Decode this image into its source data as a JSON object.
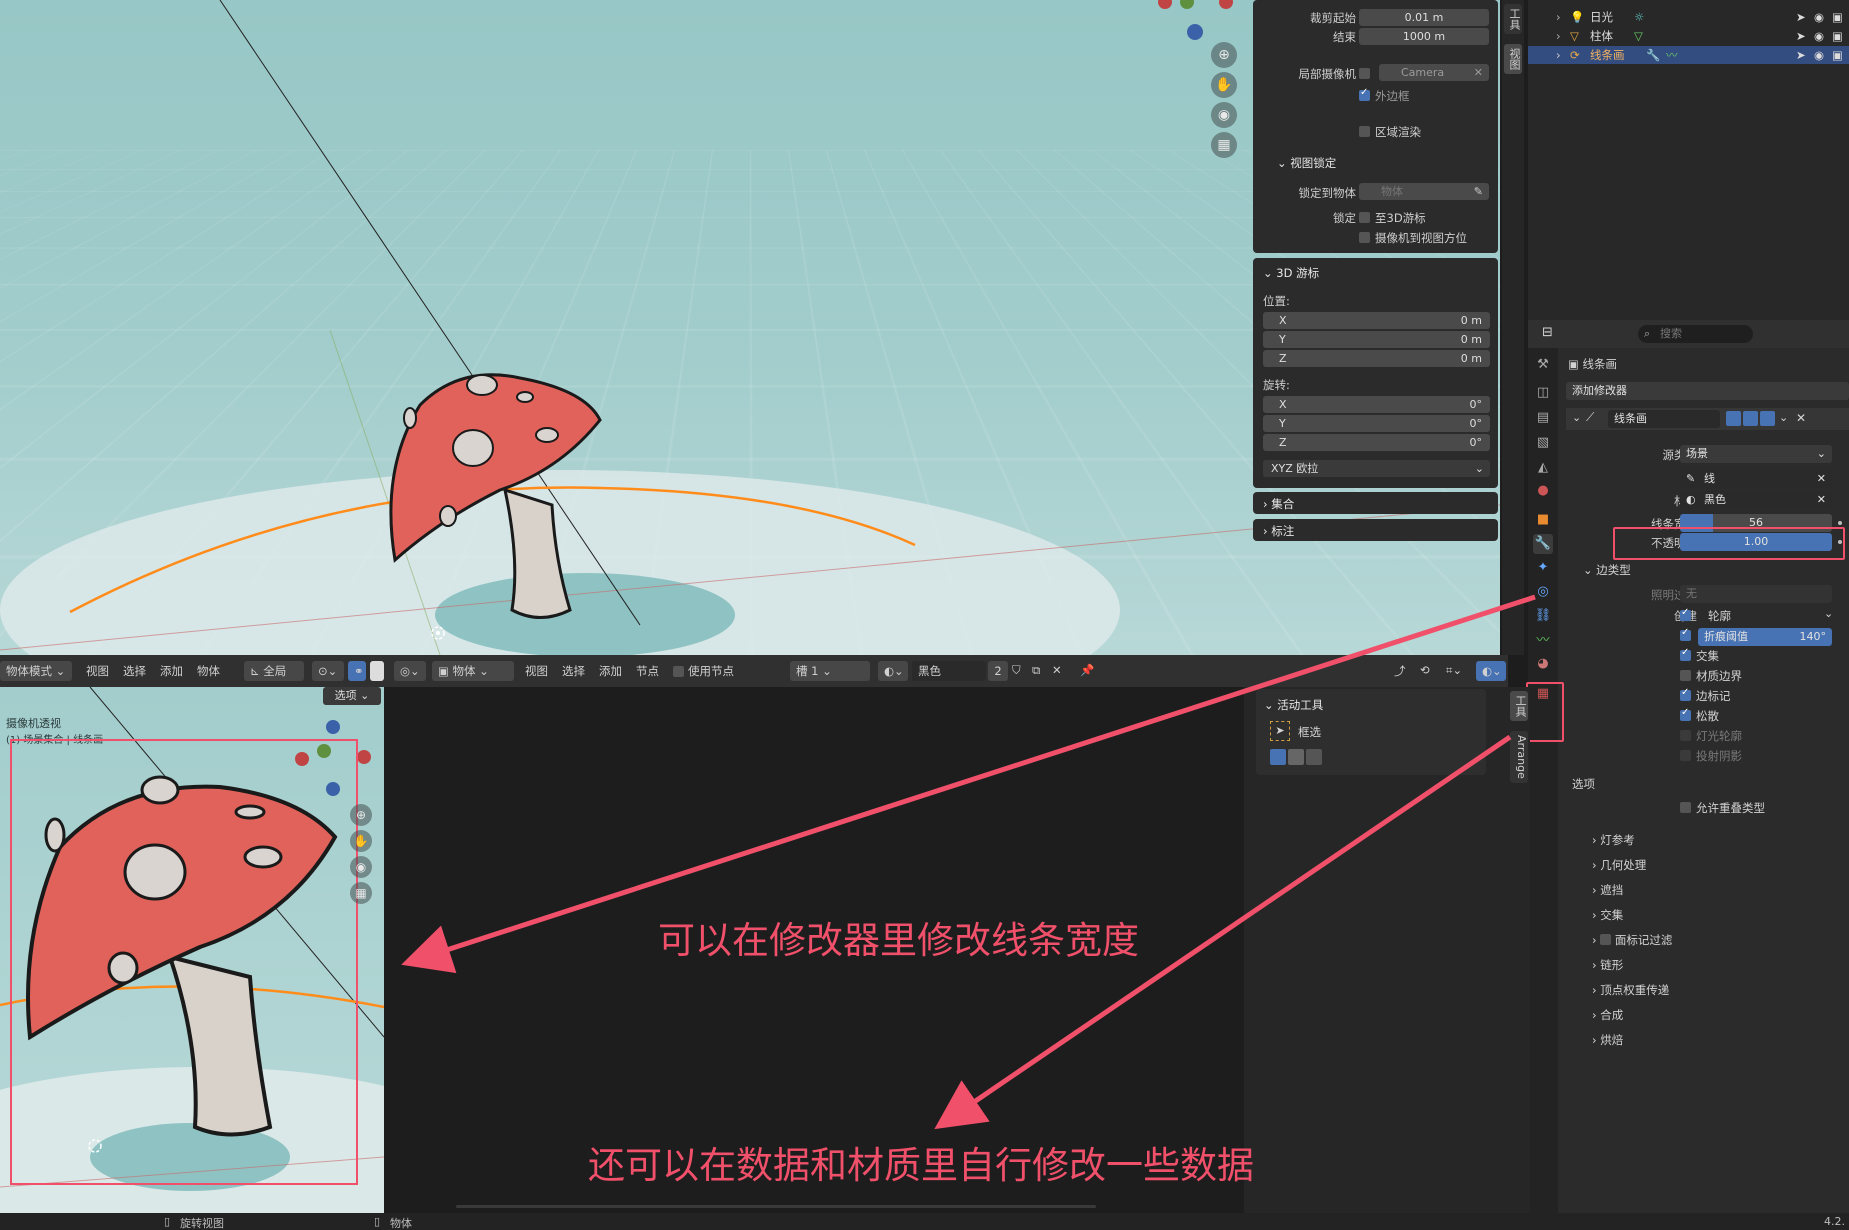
{
  "viewport_panel": {
    "clip_start_label": "裁剪起始",
    "clip_start_value": "0.01 m",
    "clip_end_label": "结束",
    "clip_end_value": "1000 m",
    "local_camera_label": "局部摄像机",
    "local_camera_value": "Camera",
    "border_label": "外边框",
    "region_render_label": "区域渲染",
    "view_lock_header": "视图锁定",
    "lock_to_object_label": "锁定到物体",
    "lock_to_object_placeholder": "物体",
    "lock_label": "锁定",
    "to_3d_cursor_label": "至3D游标",
    "camera_to_view_label": "摄像机到视图方位",
    "cursor_header": "3D 游标",
    "location_label": "位置:",
    "loc_x_label": "X",
    "loc_x": "0 m",
    "loc_y_label": "Y",
    "loc_y": "0 m",
    "loc_z_label": "Z",
    "loc_z": "0 m",
    "rotation_label": "旋转:",
    "rot_x_label": "X",
    "rot_x": "0°",
    "rot_y_label": "Y",
    "rot_y": "0°",
    "rot_z_label": "Z",
    "rot_z": "0°",
    "rotation_mode": "XYZ 欧拉",
    "collection_header": "集合",
    "annotation_header": "标注",
    "tab_tool": "工具",
    "tab_view": "视图"
  },
  "outliner": {
    "items": [
      {
        "label": "日光"
      },
      {
        "label": "柱体"
      },
      {
        "label": "线条画"
      }
    ]
  },
  "properties": {
    "search_placeholder": "搜索",
    "object_name": "线条画",
    "add_modifier": "添加修改器",
    "modifier_name": "线条画",
    "source_type_label": "源类型",
    "source_type_value": "场景",
    "layer_label": "层",
    "layer_value": "线",
    "material_label": "材质",
    "material_value": "黑色",
    "line_width_label": "线条宽度",
    "line_width_value": "56",
    "opacity_label": "不透明度",
    "opacity_value": "1.00",
    "edge_types_header": "边类型",
    "light_filter_label": "照明过滤",
    "light_filter_value": "无",
    "create_label": "创建",
    "contour_label": "轮廓",
    "crease_label": "折痕阈值",
    "crease_value": "140°",
    "intersection_label": "交集",
    "material_border_label": "材质边界",
    "edge_mark_label": "边标记",
    "loose_label": "松散",
    "light_contour_label": "灯光轮廓",
    "cast_shadow_label": "投射阴影",
    "options_label": "选项",
    "allow_overlap_label": "允许重叠类型",
    "sections": [
      "灯参考",
      "几何处理",
      "遮挡",
      "交集",
      "面标记过滤",
      "链形",
      "顶点权重传递",
      "合成",
      "烘焙"
    ]
  },
  "header_bar": {
    "mode": "物体模式",
    "menu_view": "视图",
    "menu_select": "选择",
    "menu_add": "添加",
    "menu_object": "物体",
    "orientation": "全局",
    "options": "选项",
    "editor_object": "物体",
    "n_view": "视图",
    "n_select": "选择",
    "n_add": "添加",
    "n_node": "节点",
    "use_nodes": "使用节点",
    "slot": "槽 1",
    "material": "黑色",
    "user_count": "2"
  },
  "camera_view": {
    "title": "摄像机透视",
    "subtitle": "(1) 场景集合 | 线条画"
  },
  "tool_panel": {
    "header": "活动工具",
    "tool_name": "框选",
    "tab_tool": "工具",
    "tab_arrange": "Arrange"
  },
  "status_bar": {
    "rotate_view": "旋转视图",
    "object": "物体",
    "version": "4.2."
  },
  "annotations": {
    "text1": "可以在修改器里修改线条宽度",
    "text2": "还可以在数据和材质里自行修改一些数据"
  },
  "colors": {
    "accent_blue": "#4772b3",
    "annotation_red": "#f0506a",
    "mushroom_red": "#e0625b"
  }
}
